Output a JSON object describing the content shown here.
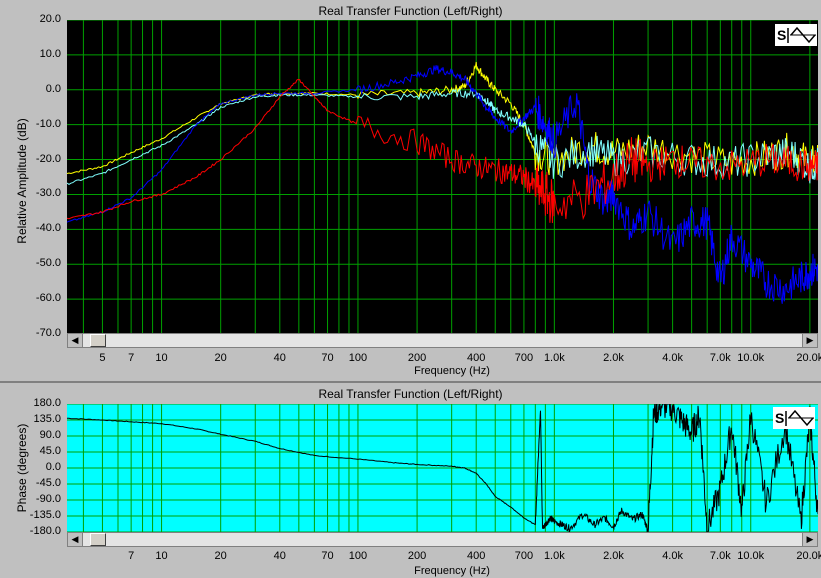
{
  "amplitude": {
    "title": "Real Transfer Function (Left/Right)",
    "ylabel": "Relative Amplitude (dB)",
    "xlabel": "Frequency (Hz)",
    "yticks": [
      "20.0",
      "10.0",
      "0.0",
      "-10.0",
      "-20.0",
      "-30.0",
      "-40.0",
      "-50.0",
      "-60.0",
      "-70.0"
    ],
    "xticks": [
      "5",
      "7",
      "10",
      "20",
      "40",
      "70",
      "100",
      "200",
      "400",
      "700",
      "1.0k",
      "2.0k",
      "4.0k",
      "7.0k",
      "10.0k",
      "20.0k"
    ],
    "logo_text": "SA"
  },
  "phase": {
    "title": "Real Transfer Function (Left/Right)",
    "ylabel": "Phase (degrees)",
    "xlabel": "Frequency (Hz)",
    "yticks": [
      "180.0",
      "135.0",
      "90.0",
      "45.0",
      "0.0",
      "-45.0",
      "-90.0",
      "-135.0",
      "-180.0"
    ],
    "xticks": [
      "7",
      "10",
      "20",
      "40",
      "70",
      "100",
      "200",
      "400",
      "700",
      "1.0k",
      "2.0k",
      "4.0k",
      "7.0k",
      "10.0k",
      "20.0k"
    ],
    "logo_text": "SA"
  },
  "chart_data": [
    {
      "type": "line",
      "title": "Real Transfer Function (Left/Right)",
      "xlabel": "Frequency (Hz)",
      "ylabel": "Relative Amplitude (dB)",
      "xscale": "log",
      "xlim": [
        3.3,
        22000
      ],
      "ylim": [
        -70,
        20
      ],
      "grid": true,
      "background": "#000000",
      "grid_color": "#00a000",
      "series": [
        {
          "color": "#ffff00",
          "x": [
            3.3,
            5,
            7,
            10,
            15,
            20,
            30,
            40,
            60,
            100,
            200,
            300,
            350,
            400,
            450,
            500,
            600,
            700,
            800,
            1000,
            1500,
            2000,
            3000,
            5000,
            8000,
            12000,
            16000,
            20000,
            22000
          ],
          "y": [
            -24,
            -22,
            -18,
            -14,
            -8,
            -4,
            -1.5,
            -1,
            -1,
            -1.5,
            -1,
            0,
            1,
            7,
            3,
            0,
            -4,
            -10,
            -18,
            -20,
            -16,
            -18,
            -16,
            -19,
            -21,
            -19,
            -17,
            -21,
            -20
          ]
        },
        {
          "color": "#80ffff",
          "x": [
            3.3,
            5,
            7,
            10,
            15,
            20,
            30,
            40,
            60,
            100,
            200,
            300,
            400,
            450,
            500,
            600,
            700,
            800,
            1000,
            1500,
            2000,
            3000,
            5000,
            8000,
            12000,
            16000,
            20000,
            22000
          ],
          "y": [
            -27,
            -24,
            -20,
            -16,
            -10,
            -5,
            -2,
            -1.5,
            -1.5,
            -2,
            -2,
            -1,
            -1,
            -3,
            -6,
            -8,
            -10,
            -15,
            -21,
            -17,
            -20,
            -18,
            -20,
            -21,
            -19,
            -18,
            -22,
            -21
          ]
        },
        {
          "color": "#0000ff",
          "x": [
            3.3,
            5,
            7,
            10,
            15,
            20,
            30,
            40,
            60,
            100,
            150,
            200,
            250,
            300,
            350,
            400,
            450,
            500,
            600,
            700,
            800,
            900,
            1000,
            1300,
            1500,
            1800,
            2000,
            2500,
            3000,
            4000,
            5000,
            6000,
            7000,
            8000,
            10000,
            12000,
            15000,
            18000,
            20000,
            22000
          ],
          "y": [
            -38,
            -35,
            -31,
            -23,
            -10,
            -4,
            -1.5,
            -1,
            -1,
            0,
            2,
            4,
            6,
            5,
            3,
            -1,
            -5,
            -8,
            -12,
            -8,
            -5,
            -10,
            -15,
            -3,
            -25,
            -32,
            -30,
            -40,
            -35,
            -45,
            -38,
            -38,
            -55,
            -42,
            -50,
            -55,
            -57,
            -54,
            -52,
            -51
          ]
        },
        {
          "color": "#ff0000",
          "x": [
            3.3,
            5,
            7,
            10,
            15,
            20,
            30,
            40,
            50,
            60,
            70,
            100,
            200,
            300,
            400,
            500,
            600,
            700,
            800,
            900,
            1000,
            1500,
            2000,
            2500,
            3000,
            4000,
            5000,
            8000,
            12000,
            16000,
            20000,
            22000
          ],
          "y": [
            -37,
            -35,
            -32,
            -30,
            -25,
            -20,
            -11,
            -2,
            3,
            -2,
            -6,
            -10,
            -15,
            -20,
            -22,
            -23,
            -24,
            -25,
            -28,
            -30,
            -33,
            -30,
            -25,
            -20,
            -22,
            -20,
            -21,
            -22,
            -20,
            -21,
            -22,
            -22
          ]
        }
      ]
    },
    {
      "type": "line",
      "title": "Real Transfer Function (Left/Right)",
      "xlabel": "Frequency (Hz)",
      "ylabel": "Phase (degrees)",
      "xscale": "log",
      "xlim": [
        3.3,
        22000
      ],
      "ylim": [
        -180,
        180
      ],
      "grid": true,
      "background": "#00ffff",
      "grid_color": "#00a000",
      "series": [
        {
          "color": "#000000",
          "x": [
            3.3,
            5,
            7,
            10,
            15,
            20,
            30,
            40,
            60,
            100,
            150,
            200,
            300,
            350,
            400,
            450,
            500,
            600,
            700,
            800,
            850,
            870,
            900,
            950,
            1000,
            1100,
            1200,
            1400,
            1600,
            1800,
            2000,
            2200,
            2500,
            2800,
            3000,
            3200,
            3500,
            4000,
            4500,
            5000,
            5500,
            6000,
            7000,
            8000,
            9000,
            10000,
            12000,
            15000,
            18000,
            20000,
            22000
          ],
          "y": [
            140,
            135,
            130,
            125,
            110,
            95,
            75,
            55,
            35,
            25,
            15,
            10,
            5,
            0,
            -15,
            -45,
            -80,
            -110,
            -140,
            -160,
            170,
            -170,
            -160,
            -140,
            -150,
            -160,
            -170,
            -130,
            -160,
            -140,
            -165,
            -120,
            -145,
            -130,
            -175,
            150,
            175,
            170,
            130,
            100,
            150,
            -170,
            -60,
            120,
            -120,
            150,
            -100,
            120,
            -150,
            140,
            -130
          ]
        }
      ]
    }
  ]
}
